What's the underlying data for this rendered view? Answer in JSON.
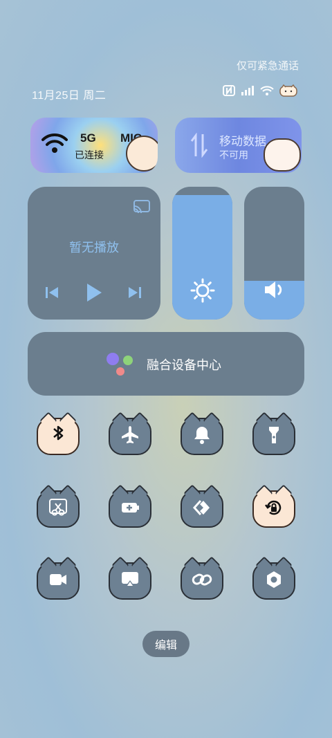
{
  "status": {
    "carrier_text": "仅可紧急通话",
    "date": "11月25日 周二"
  },
  "connectivity": {
    "wifi": {
      "name": "5G",
      "name2": "MIC",
      "status": "已连接"
    },
    "mobile_data": {
      "label": "移动数据",
      "status": "不可用"
    }
  },
  "media": {
    "now_playing": "暂无播放"
  },
  "sliders": {
    "brightness_level": 0.94,
    "volume_level": 0.29
  },
  "fusion": {
    "label": "融合设备中心"
  },
  "tiles": [
    {
      "icon": "bluetooth-icon",
      "active": true
    },
    {
      "icon": "airplane-icon",
      "active": false
    },
    {
      "icon": "bell-icon",
      "active": false
    },
    {
      "icon": "flashlight-icon",
      "active": false
    },
    {
      "icon": "screenshot-icon",
      "active": false
    },
    {
      "icon": "battery-saver-icon",
      "active": false
    },
    {
      "icon": "link-share-icon",
      "active": false
    },
    {
      "icon": "rotation-lock-icon",
      "active": true
    },
    {
      "icon": "screen-record-icon",
      "active": false
    },
    {
      "icon": "screen-cast-icon",
      "active": false
    },
    {
      "icon": "link-icon",
      "active": false
    },
    {
      "icon": "settings-icon",
      "active": false
    }
  ],
  "edit": {
    "label": "编辑"
  }
}
